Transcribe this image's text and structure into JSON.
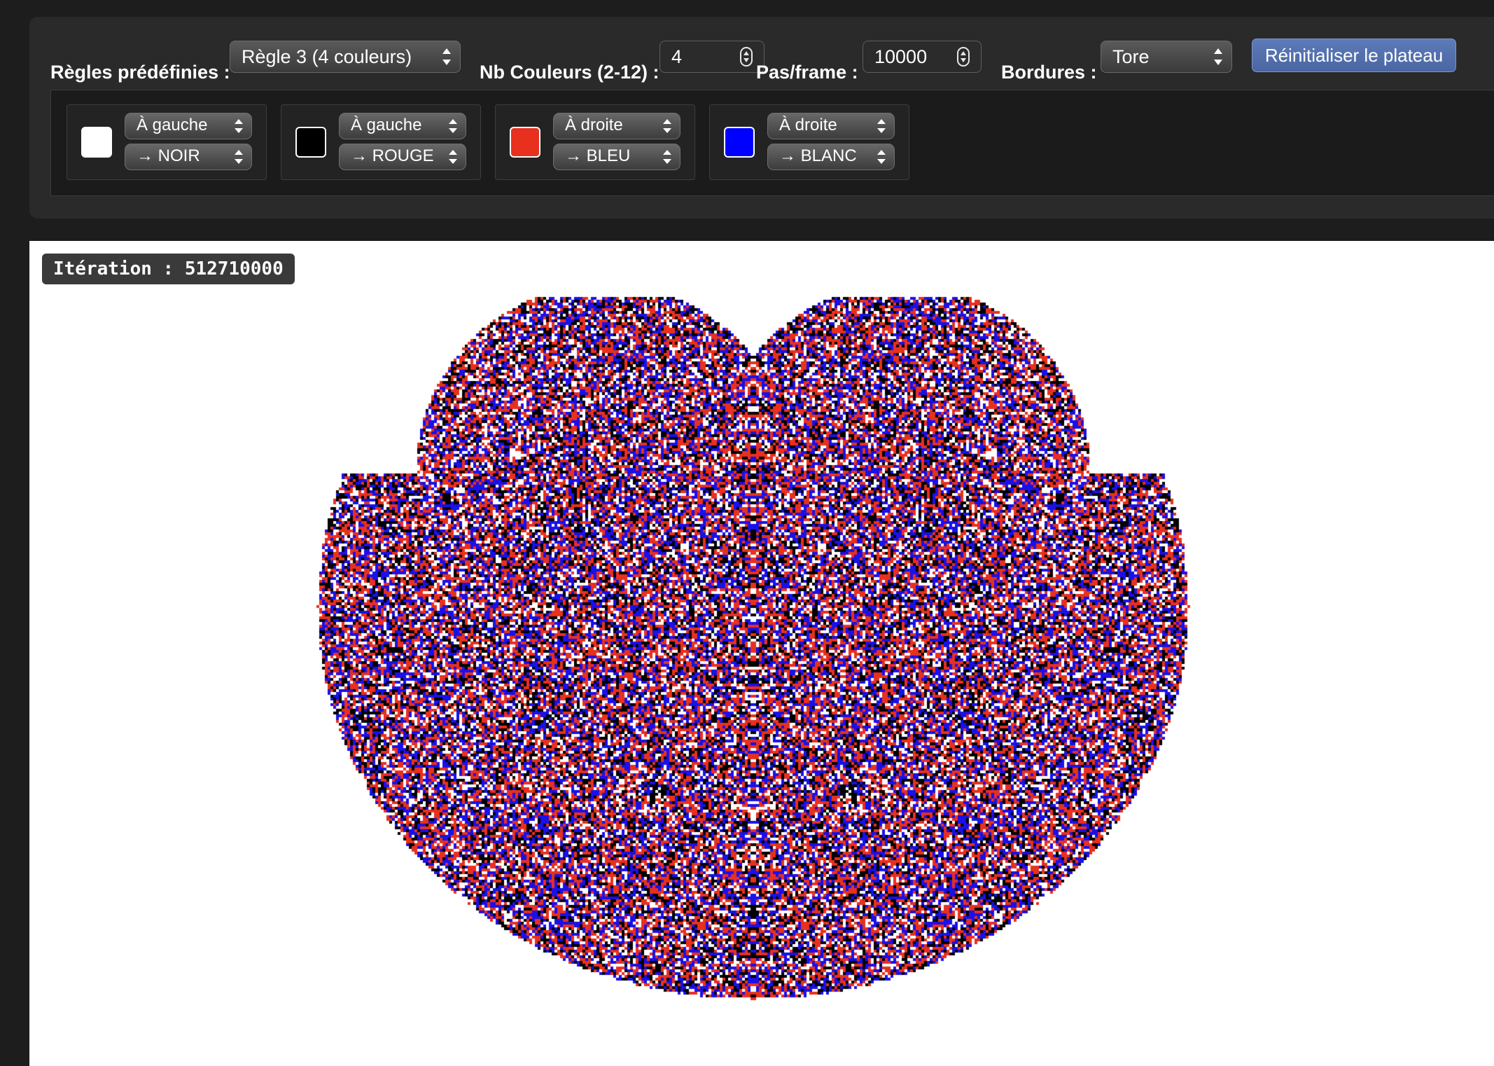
{
  "toolbar": {
    "presets_label": "Règles prédéfinies :",
    "preset_value": "Règle 3 (4 couleurs)",
    "colors_label": "Nb Couleurs (2-12) :",
    "colors_value": "4",
    "steps_label": "Pas/frame :",
    "steps_value": "10000",
    "borders_label": "Bordures :",
    "borders_value": "Tore",
    "reset_label": "Réinitialiser le plateau"
  },
  "rules": [
    {
      "color": "#ffffff",
      "direction": "À gauche",
      "target": "→ NOIR"
    },
    {
      "color": "#000000",
      "direction": "À gauche",
      "target": "→ ROUGE"
    },
    {
      "color": "#e8301f",
      "direction": "À droite",
      "target": "→ BLEU"
    },
    {
      "color": "#0000ff",
      "direction": "À droite",
      "target": "→ BLANC"
    }
  ],
  "canvas": {
    "iteration_label": "Itération : 512710000",
    "palette": [
      "#ffffff",
      "#000000",
      "#e8301f",
      "#1a10e8"
    ]
  }
}
